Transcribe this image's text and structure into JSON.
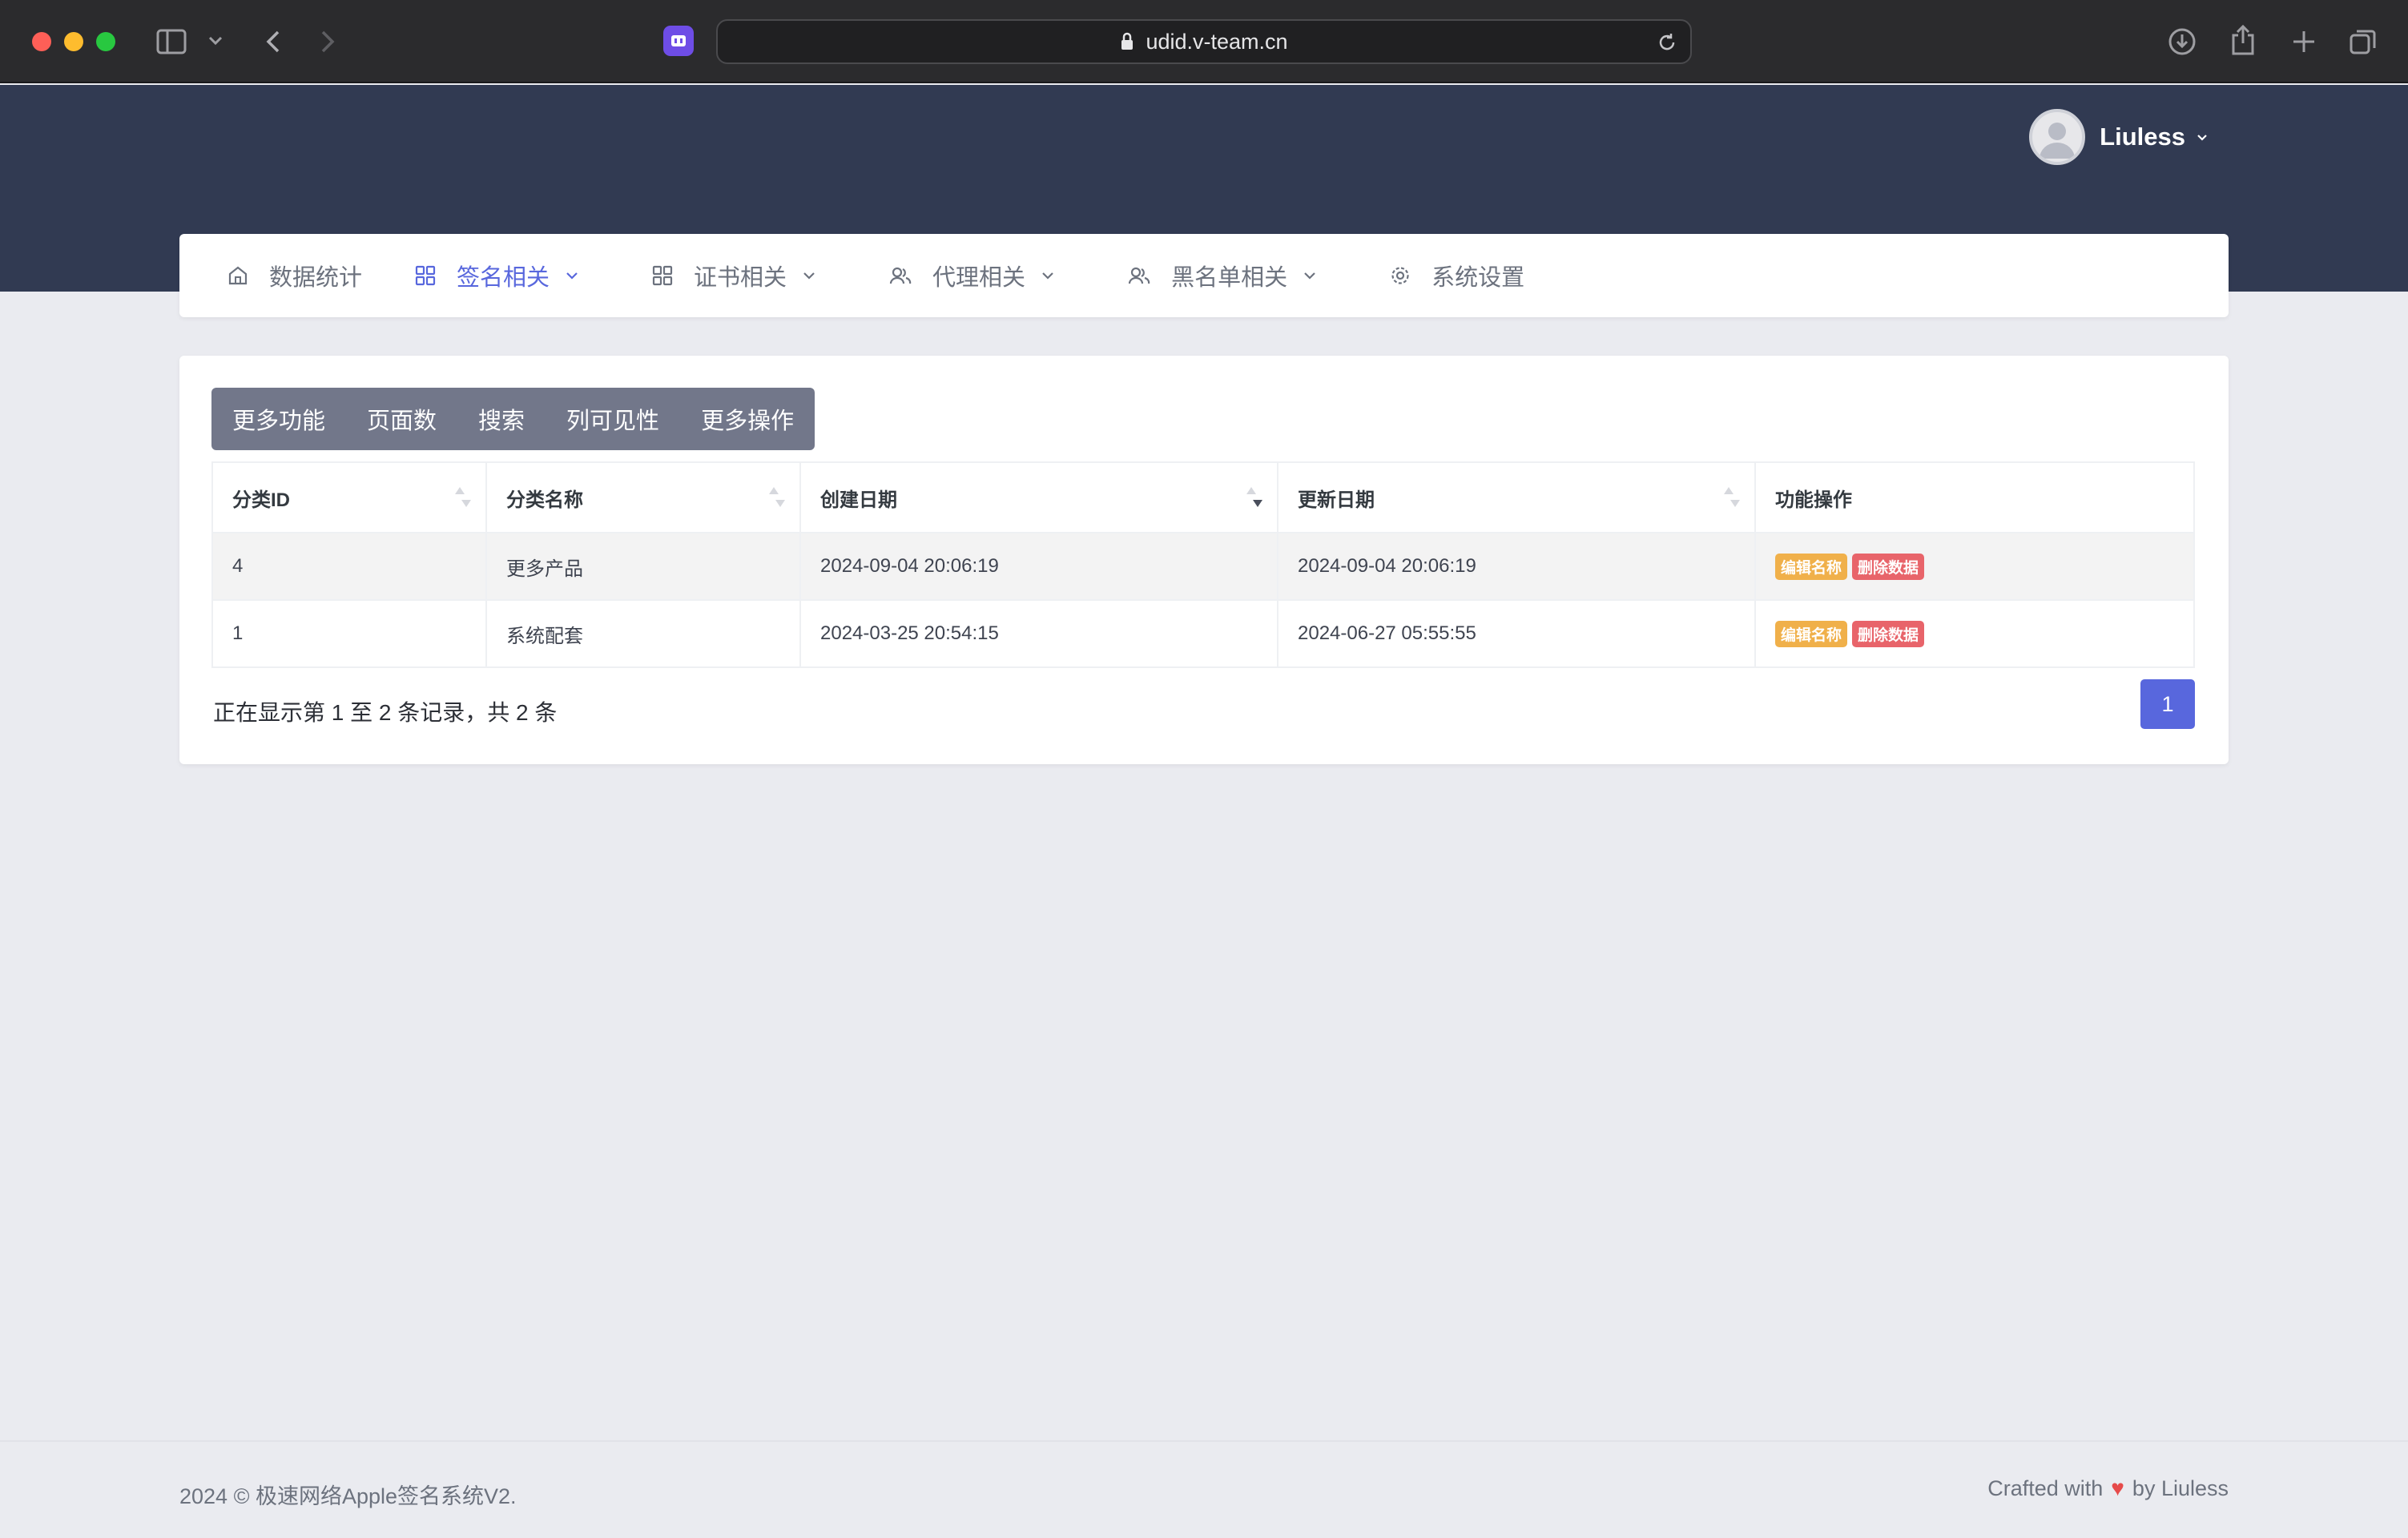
{
  "browser": {
    "url": "udid.v-team.cn"
  },
  "user": {
    "name": "Liuless"
  },
  "nav": {
    "items": [
      {
        "label": "数据统计",
        "icon": "home-icon",
        "has_caret": false
      },
      {
        "label": "签名相关",
        "icon": "grid-icon",
        "has_caret": true,
        "active": true
      },
      {
        "label": "证书相关",
        "icon": "grid-icon",
        "has_caret": true
      },
      {
        "label": "代理相关",
        "icon": "users-icon",
        "has_caret": true
      },
      {
        "label": "黑名单相关",
        "icon": "users-icon",
        "has_caret": true
      },
      {
        "label": "系统设置",
        "icon": "gear-icon",
        "has_caret": false
      }
    ]
  },
  "toolbar": {
    "buttons": [
      "更多功能",
      "页面数",
      "搜索",
      "列可见性",
      "更多操作"
    ]
  },
  "table": {
    "columns": [
      "分类ID",
      "分类名称",
      "创建日期",
      "更新日期",
      "功能操作"
    ],
    "rows": [
      {
        "id": "4",
        "name": "更多产品",
        "created": "2024-09-04 20:06:19",
        "updated": "2024-09-04 20:06:19"
      },
      {
        "id": "1",
        "name": "系统配套",
        "created": "2024-03-25 20:54:15",
        "updated": "2024-06-27 05:55:55"
      }
    ],
    "action_edit": "编辑名称",
    "action_delete": "删除数据"
  },
  "pagination": {
    "info": "正在显示第 1 至 2 条记录，共 2 条",
    "current_page": "1"
  },
  "footer": {
    "left": "2024 © 极速网络Apple签名系统V2.",
    "right_prefix": "Crafted with",
    "right_suffix": "by Liuless"
  },
  "colors": {
    "header": "#313a52",
    "accent": "#5867dd",
    "edit_badge": "#f0b04a",
    "delete_badge": "#e8646a"
  }
}
